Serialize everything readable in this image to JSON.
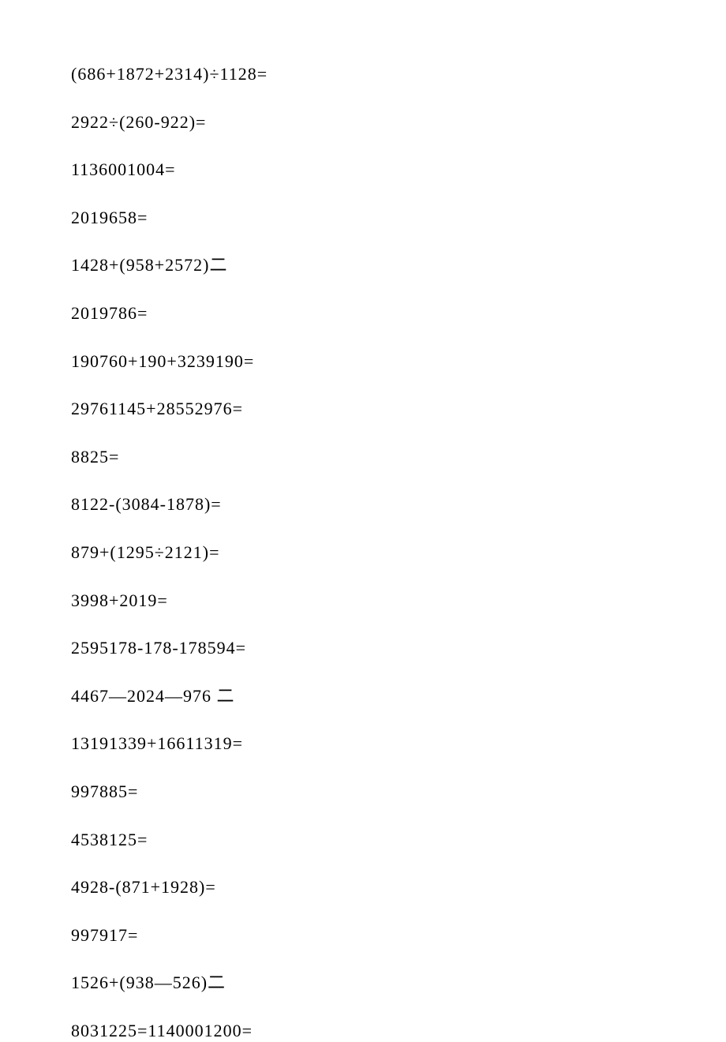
{
  "equations": [
    "(686+1872+2314)÷1128=",
    "2922÷(260-922)=",
    "1136001004=",
    "2019658=",
    "1428+(958+2572)二",
    "2019786=",
    "190760+190+3239190=",
    "29761145+28552976=",
    "8825=",
    "8122-(3084-1878)=",
    "879+(1295÷2121)=",
    "3998+2019=",
    "2595178-178-178594=",
    "4467—2024—976 二",
    "13191339+16611319=",
    "997885=",
    "4538125=",
    "4928-(871+1928)=",
    "997917=",
    "1526+(938—526)二",
    "8031225=1140001200="
  ]
}
